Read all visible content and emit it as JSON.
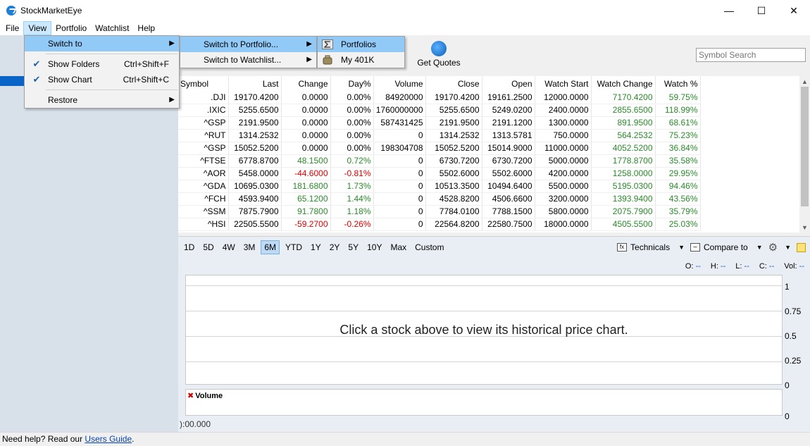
{
  "window": {
    "title": "StockMarketEye",
    "minimize": "—",
    "maximize": "☐",
    "close": "✕"
  },
  "menubar": [
    "File",
    "View",
    "Portfolio",
    "Watchlist",
    "Help"
  ],
  "toolbar": {
    "get_quotes": "Get Quotes",
    "search_placeholder": "Symbol Search"
  },
  "view_menu": {
    "switch_to": "Switch to",
    "show_folders": "Show Folders",
    "show_folders_shortcut": "Ctrl+Shift+F",
    "show_chart": "Show Chart",
    "show_chart_shortcut": "Ctrl+Shift+C",
    "restore": "Restore"
  },
  "switch_menu": {
    "portfolio": "Switch to Portfolio...",
    "watchlist": "Switch to Watchlist..."
  },
  "portfolio_menu": [
    "Portfolios",
    "My 401K"
  ],
  "grid": {
    "columns": [
      "Symbol",
      "Last",
      "Change",
      "Day%",
      "Volume",
      "Close",
      "Open",
      "Watch Start",
      "Watch Change",
      "Watch %"
    ],
    "rows": [
      {
        "symbol": ".DJI",
        "last": "19170.4200",
        "change": "0.0000",
        "day": "0.00%",
        "volume": "84920000",
        "close": "19170.4200",
        "open": "19161.2500",
        "watch_start": "12000.0000",
        "watch_change": "7170.4200",
        "watch_pct": "59.75%",
        "trend": "flat"
      },
      {
        "symbol": ".IXIC",
        "last": "5255.6500",
        "change": "0.0000",
        "day": "0.00%",
        "volume": "1760000000",
        "close": "5255.6500",
        "open": "5249.0200",
        "watch_start": "2400.0000",
        "watch_change": "2855.6500",
        "watch_pct": "118.99%",
        "trend": "flat"
      },
      {
        "symbol": "^GSP",
        "last": "2191.9500",
        "change": "0.0000",
        "day": "0.00%",
        "volume": "587431425",
        "close": "2191.9500",
        "open": "2191.1200",
        "watch_start": "1300.0000",
        "watch_change": "891.9500",
        "watch_pct": "68.61%",
        "trend": "flat"
      },
      {
        "symbol": "^RUT",
        "last": "1314.2532",
        "change": "0.0000",
        "day": "0.00%",
        "volume": "0",
        "close": "1314.2532",
        "open": "1313.5781",
        "watch_start": "750.0000",
        "watch_change": "564.2532",
        "watch_pct": "75.23%",
        "trend": "flat"
      },
      {
        "symbol": "^GSP",
        "last": "15052.5200",
        "change": "0.0000",
        "day": "0.00%",
        "volume": "198304708",
        "close": "15052.5200",
        "open": "15014.9000",
        "watch_start": "11000.0000",
        "watch_change": "4052.5200",
        "watch_pct": "36.84%",
        "trend": "flat"
      },
      {
        "symbol": "^FTSE",
        "last": "6778.8700",
        "change": "48.1500",
        "day": "0.72%",
        "volume": "0",
        "close": "6730.7200",
        "open": "6730.7200",
        "watch_start": "5000.0000",
        "watch_change": "1778.8700",
        "watch_pct": "35.58%",
        "trend": "up"
      },
      {
        "symbol": "^AOR",
        "last": "5458.0000",
        "change": "-44.6000",
        "day": "-0.81%",
        "volume": "0",
        "close": "5502.6000",
        "open": "5502.6000",
        "watch_start": "4200.0000",
        "watch_change": "1258.0000",
        "watch_pct": "29.95%",
        "trend": "down"
      },
      {
        "symbol": "^GDA",
        "last": "10695.0300",
        "change": "181.6800",
        "day": "1.73%",
        "volume": "0",
        "close": "10513.3500",
        "open": "10494.6400",
        "watch_start": "5500.0000",
        "watch_change": "5195.0300",
        "watch_pct": "94.46%",
        "trend": "up"
      },
      {
        "symbol": "^FCH",
        "last": "4593.9400",
        "change": "65.1200",
        "day": "1.44%",
        "volume": "0",
        "close": "4528.8200",
        "open": "4506.6600",
        "watch_start": "3200.0000",
        "watch_change": "1393.9400",
        "watch_pct": "43.56%",
        "trend": "up"
      },
      {
        "symbol": "^SSM",
        "last": "7875.7900",
        "change": "91.7800",
        "day": "1.18%",
        "volume": "0",
        "close": "7784.0100",
        "open": "7788.1500",
        "watch_start": "5800.0000",
        "watch_change": "2075.7900",
        "watch_pct": "35.79%",
        "trend": "up"
      },
      {
        "symbol": "^HSI",
        "last": "22505.5500",
        "change": "-59.2700",
        "day": "-0.26%",
        "volume": "0",
        "close": "22564.8200",
        "open": "22580.7500",
        "watch_start": "18000.0000",
        "watch_change": "4505.5500",
        "watch_pct": "25.03%",
        "trend": "down"
      }
    ]
  },
  "ranges": [
    "1D",
    "5D",
    "4W",
    "3M",
    "6M",
    "YTD",
    "1Y",
    "2Y",
    "5Y",
    "10Y",
    "Max",
    "Custom"
  ],
  "active_range": "6M",
  "chart_tools": {
    "technicals": "Technicals",
    "compare": "Compare to"
  },
  "ohlc": [
    {
      "k": "O:",
      "v": "--"
    },
    {
      "k": "H:",
      "v": "--"
    },
    {
      "k": "L:",
      "v": "--"
    },
    {
      "k": "C:",
      "v": "--"
    },
    {
      "k": "Vol:",
      "v": "--"
    }
  ],
  "chart": {
    "message": "Click a stock above to view its historical price chart.",
    "y_ticks": [
      "1",
      "0.75",
      "0.5",
      "0.25",
      "0"
    ],
    "volume_label": "Volume",
    "volume_zero": "0",
    "x_label": "):00.000"
  },
  "status": {
    "text": "Need help? Read our ",
    "link": "Users Guide",
    "end": "."
  }
}
